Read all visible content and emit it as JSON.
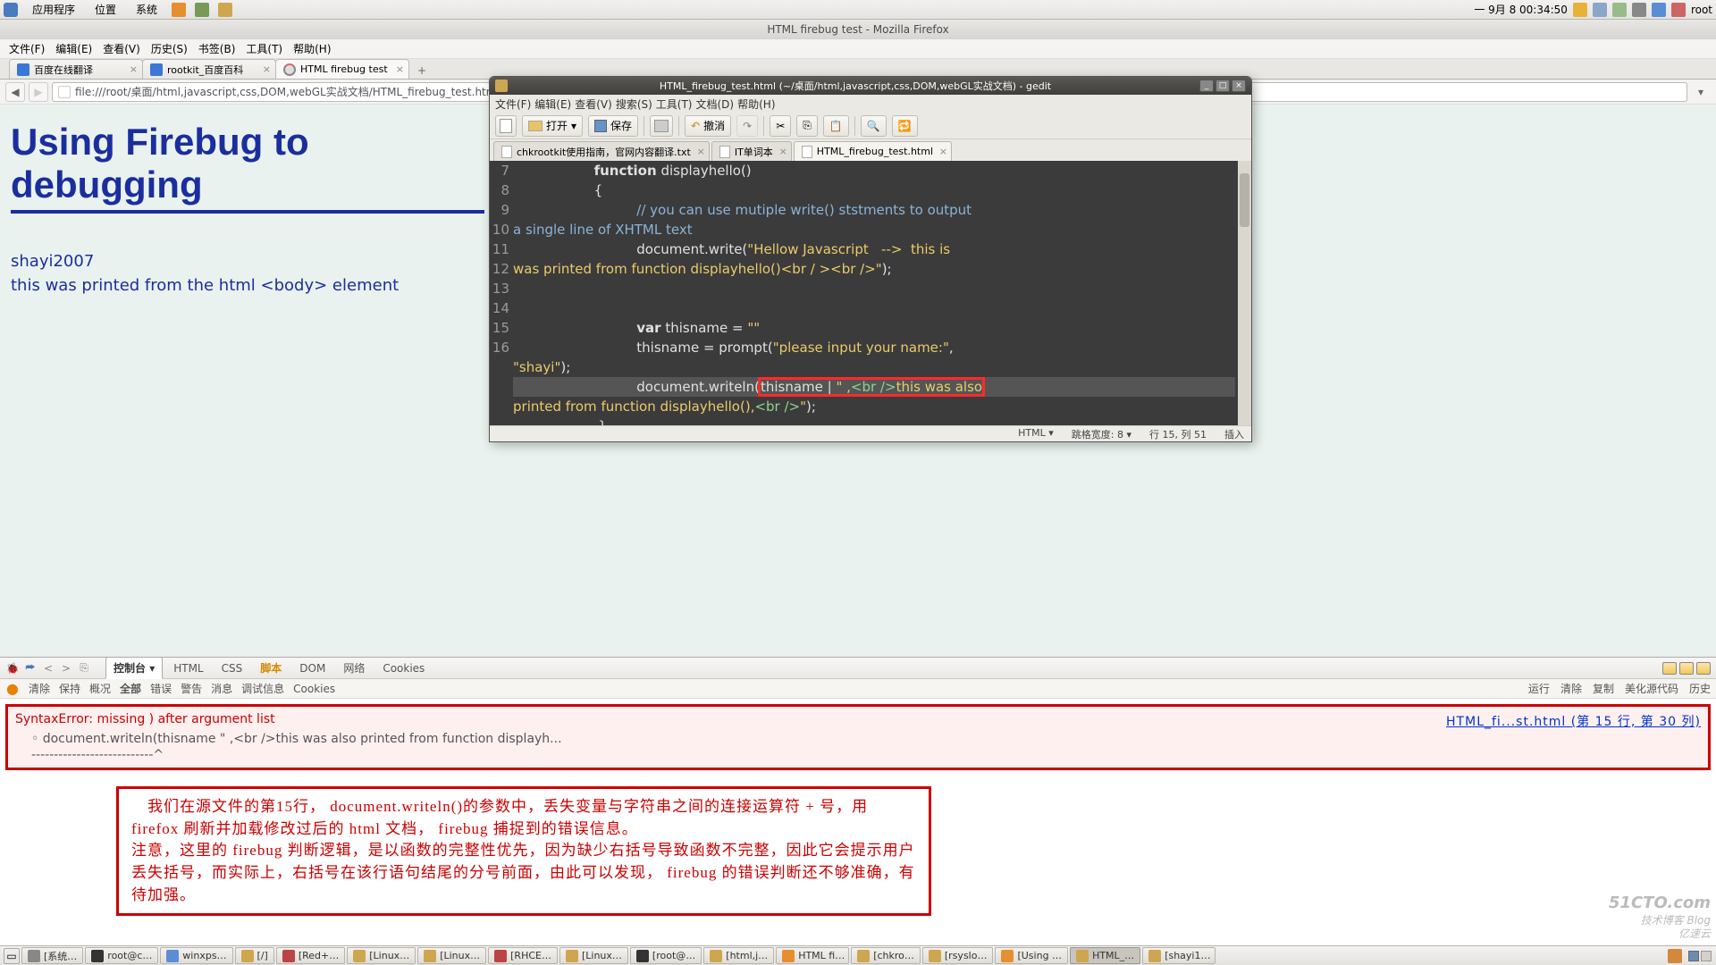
{
  "gnome_top": {
    "apps": "应用程序",
    "places": "位置",
    "system": "系统",
    "date": "一 9月  8 00:34:50",
    "user": "root"
  },
  "firefox": {
    "title": "HTML firebug test - Mozilla Firefox",
    "menus": [
      "文件(F)",
      "编辑(E)",
      "查看(V)",
      "历史(S)",
      "书签(B)",
      "工具(T)",
      "帮助(H)"
    ],
    "tabs": [
      {
        "label": "百度在线翻译"
      },
      {
        "label": "rootkit_百度百科"
      },
      {
        "label": "HTML firebug test"
      }
    ],
    "url": "file:///root/桌面/html,javascript,css,DOM,webGL实战文档/HTML_firebug_test.html"
  },
  "page": {
    "heading": "Using Firebug to debugging",
    "line1": "shayi2007",
    "line2": "this was printed from the html <body> element"
  },
  "firebug": {
    "tabs": [
      "控制台",
      "HTML",
      "CSS",
      "脚本",
      "DOM",
      "网络",
      "Cookies"
    ],
    "toolbar2_left": [
      "清除",
      "保持",
      "概况",
      "全部",
      "错误",
      "警告",
      "消息",
      "调试信息",
      "Cookies"
    ],
    "toolbar2_right": [
      "运行",
      "清除",
      "复制",
      "美化源代码",
      "历史"
    ],
    "error": {
      "msg": "SyntaxError: missing ) after argument list",
      "loc": "HTML_fi...st.html (第 15 行, 第 30 列)",
      "code": "document.writeln(thisname  \" ,<br />this was also printed from function displayh...",
      "caret": "---------------------------^"
    },
    "annotation": "　我们在源文件的第15行， document.writeln()的参数中，丢失变量与字符串之间的连接运算符 + 号，用 firefox 刷新并加载修改过后的 html 文档， firebug 捕捉到的错误信息。\n注意，这里的 firebug 判断逻辑，是以函数的完整性优先，因为缺少右括号导致函数不完整，因此它会提示用户丢失括号，而实际上，右括号在该行语句结尾的分号前面，由此可以发现， firebug 的错误判断还不够准确，有待加强。"
  },
  "gedit": {
    "title": "HTML_firebug_test.html (~/桌面/html,javascript,css,DOM,webGL实战文档) - gedit",
    "menus": [
      "文件(F)",
      "编辑(E)",
      "查看(V)",
      "搜索(S)",
      "工具(T)",
      "文档(D)",
      "帮助(H)"
    ],
    "btn_open": "打开",
    "btn_save": "保存",
    "btn_undo": "撤消",
    "tabs": [
      {
        "label": "chkrootkit使用指南，官网内容翻译.txt"
      },
      {
        "label": "IT单词本"
      },
      {
        "label": "HTML_firebug_test.html"
      }
    ],
    "status": {
      "lang": "HTML",
      "tabwidth": "跳格宽度:  8",
      "pos": "行 15, 列 51",
      "ins": "插入"
    }
  },
  "taskbar": [
    "[系统…",
    "root@c…",
    "winxps…",
    "[/]",
    "[Red+…",
    "[Linux…",
    "[Linux…",
    "[RHCE…",
    "[Linux…",
    "[root@…",
    "[html,j…",
    "HTML fi…",
    "[chkro…",
    "[rsyslo…",
    "[Using …",
    "HTML_…",
    "[shayi1…"
  ],
  "watermark": {
    "l1": "51CTO.com",
    "l2": "技术博客  Blog",
    "l3": "亿速云"
  }
}
